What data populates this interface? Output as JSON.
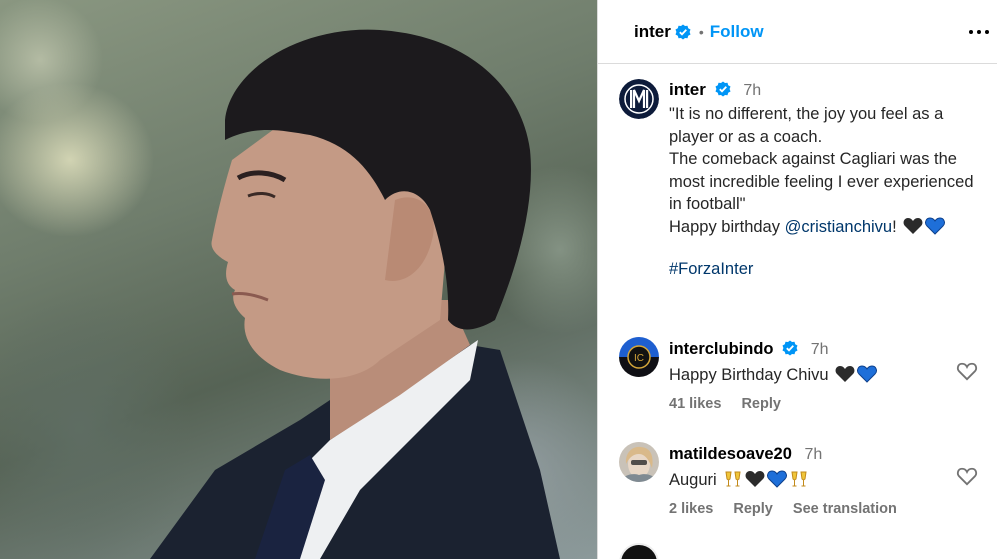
{
  "header": {
    "username": "inter",
    "dot": "•",
    "follow_label": "Follow",
    "more_icon": "more-options-icon"
  },
  "post": {
    "username": "inter",
    "time": "7h",
    "caption": "\"It is no different, the joy you feel as a player or as a coach.\nThe comeback against Cagliari was the most incredible feeling I ever experienced in football\"",
    "birthday_prefix": "Happy birthday ",
    "mention": "@cristianchivu",
    "birthday_suffix": "! ",
    "hashtag": "#ForzaInter"
  },
  "comments": [
    {
      "username": "interclubindo",
      "verified": true,
      "time": "7h",
      "text": "Happy Birthday Chivu ",
      "likes": "41 likes",
      "reply_label": "Reply"
    },
    {
      "username": "matildesoave20",
      "verified": false,
      "time": "7h",
      "text": "Auguri ",
      "likes": "2 likes",
      "reply_label": "Reply",
      "translation_label": "See translation"
    }
  ],
  "colors": {
    "link": "#0095f6",
    "mention": "#00376b",
    "verified": "#0095f6",
    "muted": "#737373",
    "inter_blue": "#1e6fd9"
  }
}
